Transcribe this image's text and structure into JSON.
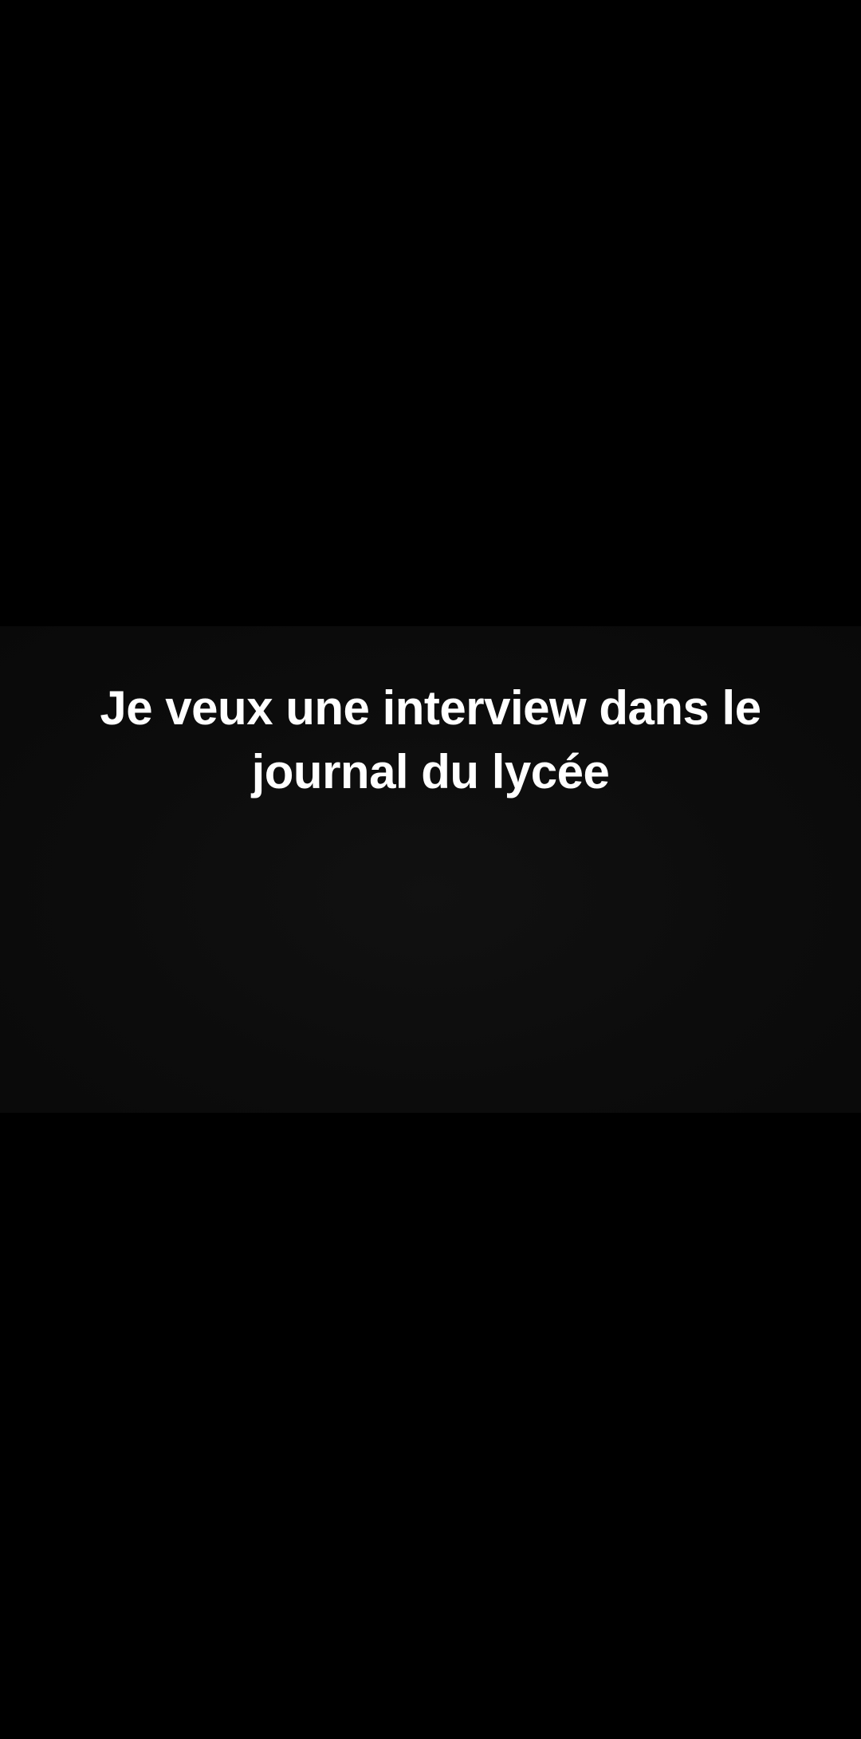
{
  "video": {
    "caption": "Je veux une interview dans le journal du lycée"
  },
  "colors": {
    "background": "#000000",
    "video_frame": "#0c0c0c",
    "caption_text": "#ffffff"
  }
}
